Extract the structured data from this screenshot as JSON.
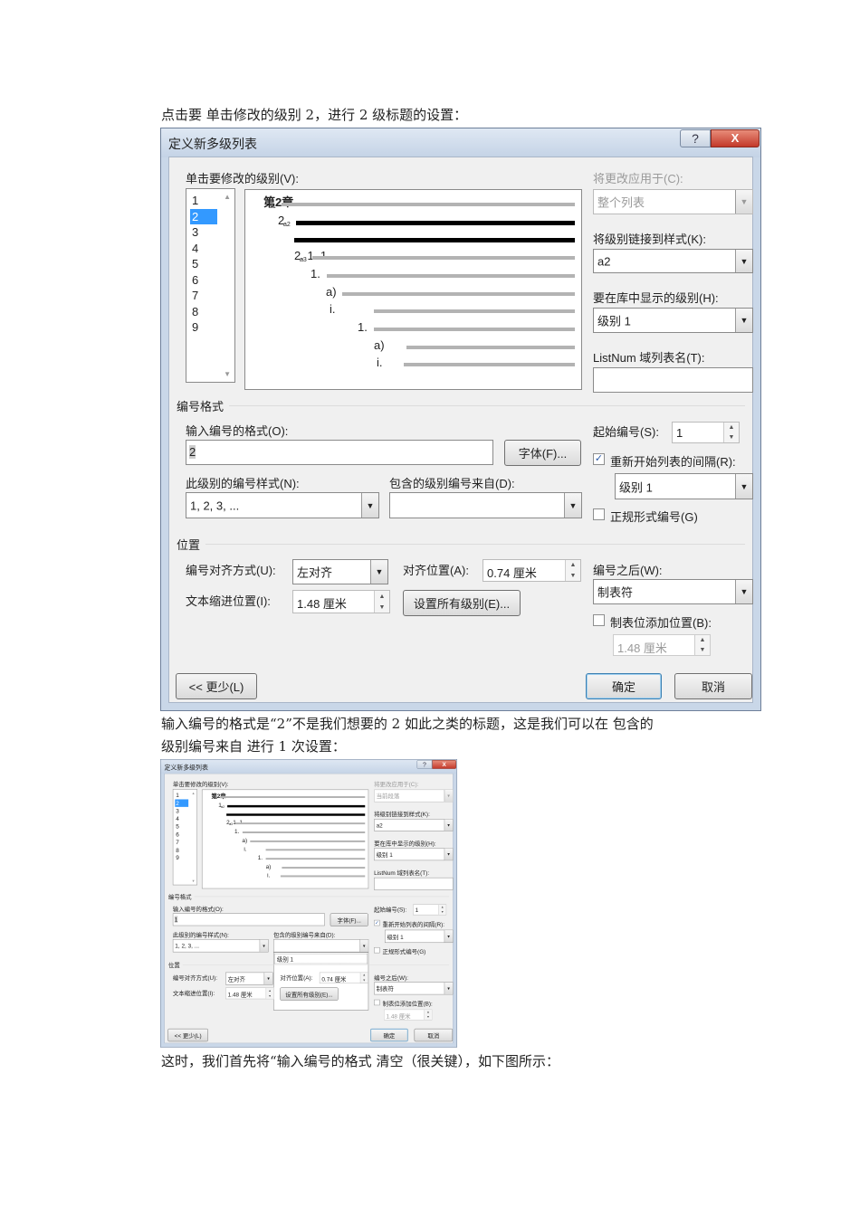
{
  "paragraphs": [
    "点击要 单击修改的级别 2，进行 2 级标题的设置：",
    "输入编号的格式是“2”不是我们想要的   2  如此之类的标题，这是我们可以在 包含的",
    "级别编号来自 进行 1 次设置：",
    "这时，我们首先将“输入编号的格式 清空（很关键），如下图所示："
  ],
  "dialog1": {
    "title": "定义新多级列表",
    "help": "?",
    "close": "X",
    "level_label": "单击要修改的级别(V):",
    "levels": [
      "1",
      "2",
      "3",
      "4",
      "5",
      "6",
      "7",
      "8",
      "9"
    ],
    "selected_level": "2",
    "preview": [
      {
        "label": "第2章",
        "tag": "a1",
        "thick": false
      },
      {
        "label": "2",
        "tag": "a2",
        "thick": true
      },
      {
        "label": "",
        "tag": "",
        "thick": true
      },
      {
        "label": "2. 1. 1",
        "tag": "a3",
        "thick": false
      },
      {
        "label": "1.",
        "tag": "",
        "thick": false
      },
      {
        "label": "a)",
        "tag": "",
        "thick": false
      },
      {
        "label": "i.",
        "tag": "",
        "thick": false
      },
      {
        "label": "1.",
        "tag": "",
        "thick": false
      },
      {
        "label": "a)",
        "tag": "",
        "thick": false
      },
      {
        "label": "i.",
        "tag": "",
        "thick": false
      }
    ],
    "apply_to_label": "将更改应用于(C):",
    "apply_to_value": "整个列表",
    "link_style_label": "将级别链接到样式(K):",
    "link_style_value": "a2",
    "gallery_level_label": "要在库中显示的级别(H):",
    "gallery_level_value": "级别 1",
    "listnum_label": "ListNum 域列表名(T):",
    "listnum_value": "",
    "number_format_section": "编号格式",
    "enter_format_label": "输入编号的格式(O):",
    "enter_format_value": "2",
    "font_button": "字体(F)...",
    "start_at_label": "起始编号(S):",
    "start_at_value": "1",
    "restart_label": "重新开始列表的间隔(R):",
    "restart_checked": true,
    "restart_value": "级别 1",
    "legal_label": "正规形式编号(G)",
    "legal_checked": false,
    "number_style_label": "此级别的编号样式(N):",
    "number_style_value": "1, 2, 3, ...",
    "include_from_label": "包含的级别编号来自(D):",
    "include_from_value": "",
    "include_from_options": [
      "级别 1"
    ],
    "position_section": "位置",
    "alignment_label": "编号对齐方式(U):",
    "alignment_value": "左对齐",
    "aligned_at_label": "对齐位置(A):",
    "aligned_at_value": "0.74 厘米",
    "follow_label": "编号之后(W):",
    "follow_value": "制表符",
    "indent_label": "文本缩进位置(I):",
    "indent_value": "1.48 厘米",
    "set_all_button": "设置所有级别(E)...",
    "tab_stop_label": "制表位添加位置(B):",
    "tab_stop_checked": false,
    "tab_stop_value": "1.48 厘米",
    "less_button": "<< 更少(L)",
    "ok_button": "确定",
    "cancel_button": "取消"
  },
  "dialog2": {
    "title": "定义新多级列表",
    "help": "?",
    "close": "X",
    "level_label": "单击要修改的级别(V):",
    "levels": [
      "1",
      "2",
      "3",
      "4",
      "5",
      "6",
      "7",
      "8",
      "9"
    ],
    "selected_level": "2",
    "preview": [
      {
        "label": "第2章",
        "tag": "a1",
        "thick": false
      },
      {
        "label": "1",
        "tag": "a2",
        "thick": true
      },
      {
        "label": "",
        "tag": "",
        "thick": true
      },
      {
        "label": "2. 1. 1",
        "tag": "a3",
        "thick": false
      },
      {
        "label": "1.",
        "tag": "",
        "thick": false
      },
      {
        "label": "a)",
        "tag": "",
        "thick": false
      },
      {
        "label": "i.",
        "tag": "",
        "thick": false
      },
      {
        "label": "1.",
        "tag": "",
        "thick": false
      },
      {
        "label": "a)",
        "tag": "",
        "thick": false
      },
      {
        "label": "i.",
        "tag": "",
        "thick": false
      }
    ],
    "apply_to_label": "将更改应用于(C):",
    "apply_to_value": "当前段落",
    "link_style_label": "将级别链接到样式(K):",
    "link_style_value": "a2",
    "gallery_level_label": "要在库中显示的级别(H):",
    "gallery_level_value": "级别 1",
    "listnum_label": "ListNum 域列表名(T):",
    "listnum_value": "",
    "number_format_section": "编号格式",
    "enter_format_label": "输入编号的格式(O):",
    "enter_format_value": "1",
    "font_button": "字体(F)...",
    "start_at_label": "起始编号(S):",
    "start_at_value": "1",
    "restart_label": "重新开始列表的间隔(R):",
    "restart_checked": true,
    "restart_value": "级别 1",
    "legal_label": "正规形式编号(G)",
    "legal_checked": false,
    "number_style_label": "此级别的编号样式(N):",
    "number_style_value": "1, 2, 3, ...",
    "include_from_label": "包含的级别编号来自(D):",
    "include_from_value": "",
    "include_from_options": [
      "级别 1"
    ],
    "position_section": "位置",
    "alignment_label": "编号对齐方式(U):",
    "alignment_value": "左对齐",
    "aligned_at_label": "对齐位置(A):",
    "aligned_at_value": "0.74 厘米",
    "follow_label": "编号之后(W):",
    "follow_value": "制表符",
    "indent_label": "文本缩进位置(I):",
    "indent_value": "1.48 厘米",
    "set_all_button": "设置所有级别(E)...",
    "tab_stop_label": "制表位添加位置(B):",
    "tab_stop_checked": false,
    "tab_stop_value": "1.48 厘米",
    "less_button": "<< 更少(L)",
    "ok_button": "确定",
    "cancel_button": "取消"
  }
}
